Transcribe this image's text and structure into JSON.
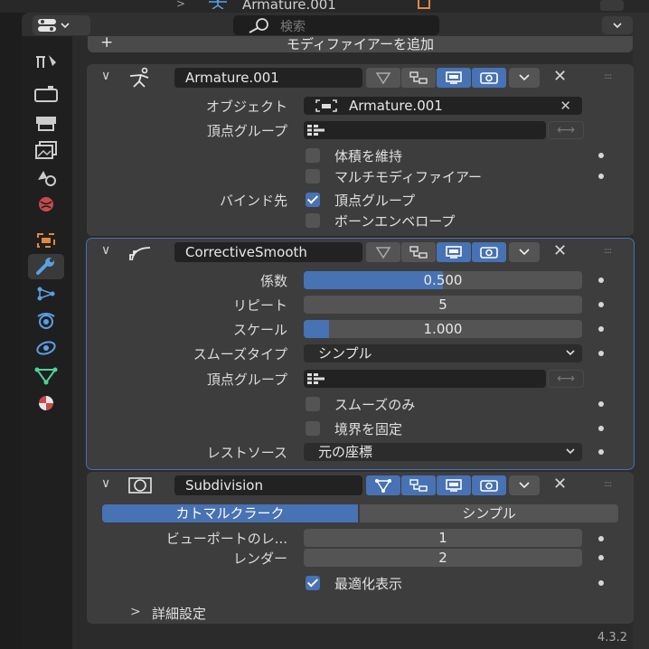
{
  "outliner": {
    "object_name": "Armature.001",
    "expander": ">"
  },
  "header": {
    "search_placeholder": "検索",
    "add_modifier_label": "モディファイアーを追加",
    "add_modifier_plus": "+"
  },
  "icons": {
    "chevron": "∨",
    "close": "✕",
    "dropdown": "⌄",
    "swap": "⟷",
    "grip": "::::"
  },
  "armature_modifier": {
    "name": "Armature.001",
    "object_label": "オブジェクト",
    "object_value": "Armature.001",
    "vertex_group_label": "頂点グループ",
    "preserve_volume_label": "体積を維持",
    "preserve_volume": false,
    "multi_modifier_label": "マルチモディファイアー",
    "multi_modifier": false,
    "bind_to_label": "バインド先",
    "bind_vertex_groups_label": "頂点グループ",
    "bind_vertex_groups": true,
    "bind_bone_envelopes_label": "ボーンエンベロープ",
    "bind_bone_envelopes": false
  },
  "corrective_smooth_modifier": {
    "name": "CorrectiveSmooth",
    "factor_label": "係数",
    "factor_value": "0.500",
    "factor_fraction": 0.5,
    "repeat_label": "リピート",
    "repeat_value": "5",
    "scale_label": "スケール",
    "scale_value": "1.000",
    "scale_fraction": 0.09,
    "smooth_type_label": "スムーズタイプ",
    "smooth_type_value": "シンプル",
    "vertex_group_label": "頂点グループ",
    "only_smooth_label": "スムーズのみ",
    "only_smooth": false,
    "pin_boundary_label": "境界を固定",
    "pin_boundary": false,
    "rest_source_label": "レストソース",
    "rest_source_value": "元の座標"
  },
  "subdivision_modifier": {
    "name": "Subdivision",
    "mode_catmull_clark": "カトマルクラーク",
    "mode_simple": "シンプル",
    "active_mode": "カトマルクラーク",
    "viewport_levels_label": "ビューポートのレ...",
    "viewport_levels_value": "1",
    "render_levels_label": "レンダー",
    "render_levels_value": "2",
    "optimal_display_label": "最適化表示",
    "optimal_display": true,
    "advanced_label": "詳細設定",
    "advanced_expander": ">"
  },
  "footer": {
    "version": "4.3.2"
  },
  "colors": {
    "accent": "#4772b3",
    "panel": "#3d3d3d",
    "background": "#2b2b2b"
  }
}
